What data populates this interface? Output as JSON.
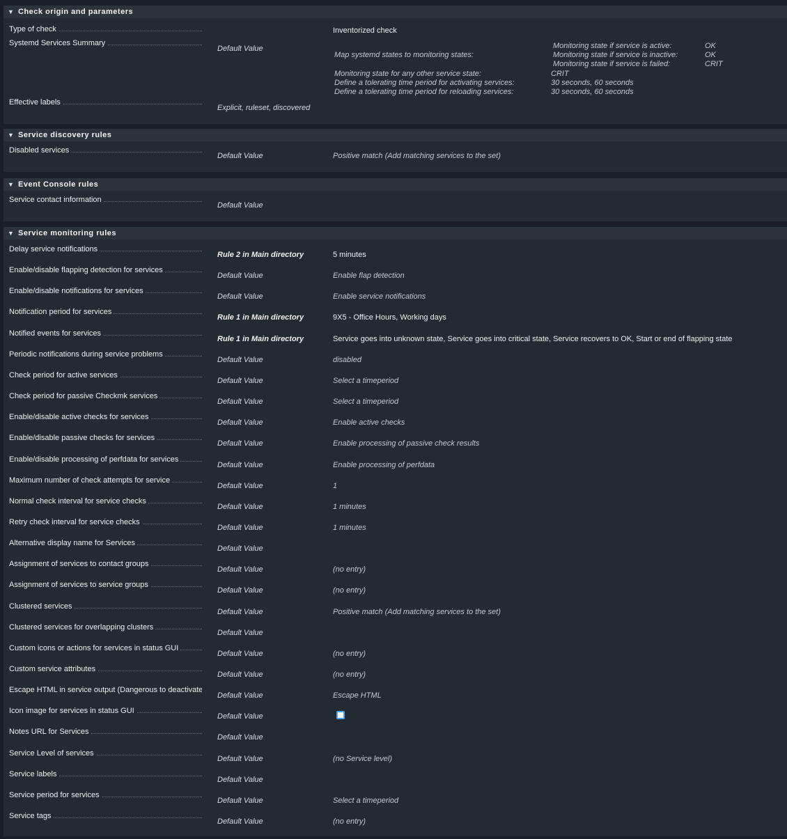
{
  "sections": {
    "origin": {
      "title": "Check origin and parameters",
      "type_of_check": {
        "label": "Type of check",
        "value": "Inventorized check"
      },
      "systemd": {
        "label": "Systemd Services Summary",
        "origin": "Default Value",
        "map_label": "Map systemd states to monitoring states:",
        "active_label": "Monitoring state if service is active:",
        "active_val": "OK",
        "inactive_label": "Monitoring state if service is inactive:",
        "inactive_val": "OK",
        "failed_label": "Monitoring state if service is failed:",
        "failed_val": "CRIT",
        "other_label": "Monitoring state for any other service state:",
        "other_val": "CRIT",
        "activating_label": "Define a tolerating time period for activating services:",
        "activating_val": "30 seconds, 60 seconds",
        "reloading_label": "Define a tolerating time period for reloading services:",
        "reloading_val": "30 seconds, 60 seconds"
      },
      "labels": {
        "label": "Effective labels",
        "origin": "Explicit, ruleset, discovered"
      }
    },
    "discovery": {
      "title": "Service discovery rules",
      "rows": [
        {
          "label": "Disabled services",
          "origin": "Default Value",
          "value": "Positive match (Add matching services to the set)"
        }
      ]
    },
    "event": {
      "title": "Event Console rules",
      "rows": [
        {
          "label": "Service contact information",
          "origin": "Default Value",
          "value": ""
        }
      ]
    },
    "monitoring": {
      "title": "Service monitoring rules",
      "rows": [
        {
          "label": "Delay service notifications",
          "origin": "Rule 2 in Main directory",
          "value": "5 minutes"
        },
        {
          "label": "Enable/disable flapping detection for services",
          "origin": "Default Value",
          "value": "Enable flap detection"
        },
        {
          "label": "Enable/disable notifications for services",
          "origin": "Default Value",
          "value": "Enable service notifications"
        },
        {
          "label": "Notification period for services",
          "origin": "Rule 1 in Main directory",
          "value": "9X5 - Office Hours, Working days"
        },
        {
          "label": "Notified events for services",
          "origin": "Rule 1 in Main directory",
          "value": "Service goes into unknown state, Service goes into critical state, Service recovers to OK, Start or end of flapping state"
        },
        {
          "label": "Periodic notifications during service problems",
          "origin": "Default Value",
          "value": "disabled"
        },
        {
          "label": "Check period for active services",
          "origin": "Default Value",
          "value": "Select a timeperiod"
        },
        {
          "label": "Check period for passive Checkmk services",
          "origin": "Default Value",
          "value": "Select a timeperiod"
        },
        {
          "label": "Enable/disable active checks for services",
          "origin": "Default Value",
          "value": "Enable active checks"
        },
        {
          "label": "Enable/disable passive checks for services",
          "origin": "Default Value",
          "value": "Enable processing of passive check results"
        },
        {
          "label": "Enable/disable processing of perfdata for services",
          "origin": "Default Value",
          "value": "Enable processing of perfdata"
        },
        {
          "label": "Maximum number of check attempts for service",
          "origin": "Default Value",
          "value": "1"
        },
        {
          "label": "Normal check interval for service checks",
          "origin": "Default Value",
          "value": "1 minutes"
        },
        {
          "label": "Retry check interval for service checks",
          "origin": "Default Value",
          "value": "1 minutes"
        },
        {
          "label": "Alternative display name for Services",
          "origin": "Default Value",
          "value": ""
        },
        {
          "label": "Assignment of services to contact groups",
          "origin": "Default Value",
          "value": "(no entry)"
        },
        {
          "label": "Assignment of services to service groups",
          "origin": "Default Value",
          "value": "(no entry)"
        },
        {
          "label": "Clustered services",
          "origin": "Default Value",
          "value": "Positive match (Add matching services to the set)"
        },
        {
          "label": "Clustered services for overlapping clusters",
          "origin": "Default Value",
          "value": ""
        },
        {
          "label": "Custom icons or actions for services in status GUI",
          "origin": "Default Value",
          "value": "(no entry)"
        },
        {
          "label": "Custom service attributes",
          "origin": "Default Value",
          "value": "(no entry)"
        },
        {
          "label": "Escape HTML in service output (Dangerous to deactivate - read help)",
          "origin": "Default Value",
          "value": "Escape HTML"
        },
        {
          "label": "Icon image for services in status GUI",
          "origin": "Default Value",
          "value": ""
        },
        {
          "label": "Notes URL for Services",
          "origin": "Default Value",
          "value": ""
        },
        {
          "label": "Service Level of services",
          "origin": "Default Value",
          "value": "(no Service level)"
        },
        {
          "label": "Service labels",
          "origin": "Default Value",
          "value": ""
        },
        {
          "label": "Service period for services",
          "origin": "Default Value",
          "value": "Select a timeperiod"
        },
        {
          "label": "Service tags",
          "origin": "Default Value",
          "value": "(no entry)"
        }
      ]
    }
  },
  "icons": {
    "collapse": "triangle-down-icon",
    "checkbox": "checkbox-icon"
  },
  "colors": {
    "background": "#1a1f25",
    "panel": "#232a31",
    "header": "#2b333b",
    "checkbox_border": "#4aa3f0"
  }
}
